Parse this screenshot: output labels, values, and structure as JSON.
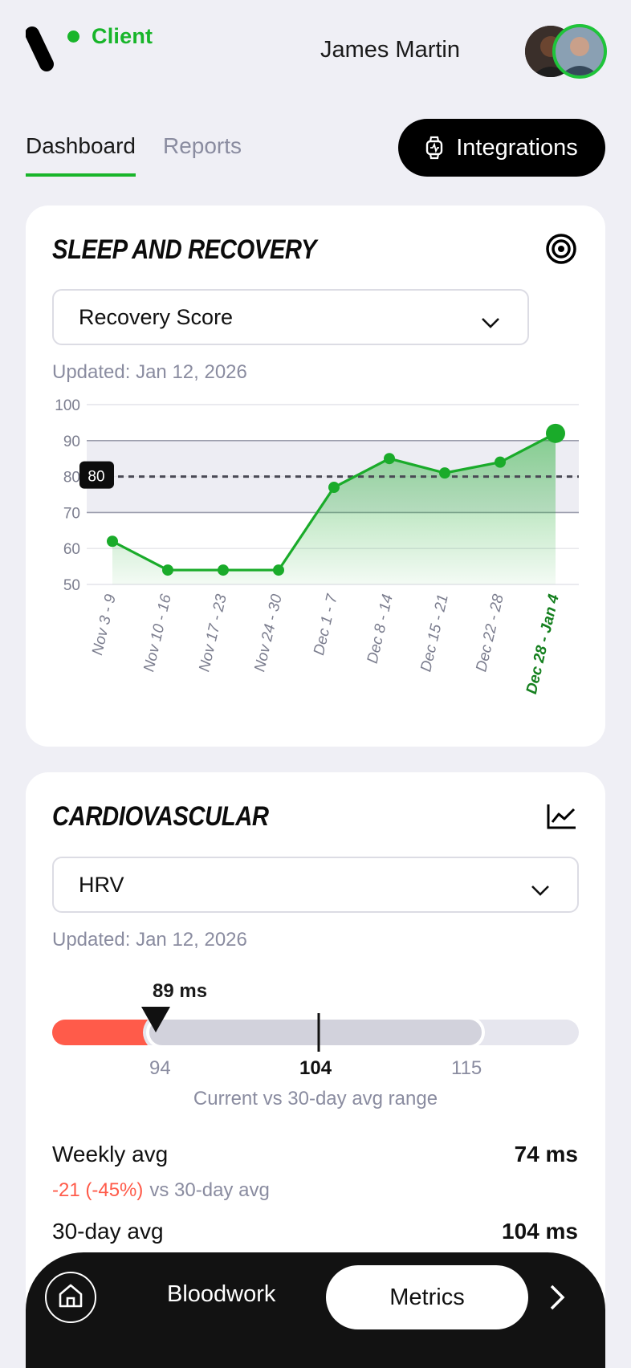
{
  "header": {
    "brand": "Client",
    "user_name": "James Martin",
    "accent": "#18b52a"
  },
  "tabs": [
    {
      "label": "Dashboard",
      "active": true
    },
    {
      "label": "Reports",
      "active": false
    }
  ],
  "integrations_label": "Integrations",
  "sleep_card": {
    "title": "SLEEP AND RECOVERY",
    "icon": "target-icon",
    "select_value": "Recovery Score",
    "updated": "Updated: Jan 12, 2026",
    "target_badge": "80"
  },
  "chart_data": {
    "type": "area",
    "categories": [
      "Nov 3 - 9",
      "Nov 10 - 16",
      "Nov 17 - 23",
      "Nov 24 - 30",
      "Dec 1 - 7",
      "Dec 8 - 14",
      "Dec 15 - 21",
      "Dec 22 - 28",
      "Dec 28 - Jan 4"
    ],
    "values": [
      62,
      54,
      54,
      54,
      77,
      85,
      81,
      84,
      92
    ],
    "yticks": [
      100,
      90,
      80,
      70,
      60,
      50
    ],
    "ylim": [
      50,
      100
    ],
    "target": 80,
    "highlight_index": 8,
    "line_color": "#1aab2a",
    "grid": true
  },
  "cardio_card": {
    "title": "CARDIOVASCULAR",
    "icon": "line-chart-icon",
    "select_value": "HRV",
    "updated": "Updated: Jan 12, 2026",
    "current_label": "89 ms",
    "range_low": "94",
    "range_mid": "104",
    "range_high": "115",
    "range_caption": "Current vs 30-day avg range",
    "weekly_label": "Weekly avg",
    "weekly_value": "74 ms",
    "weekly_delta": "-21 (-45%)",
    "weekly_vs": "vs 30-day avg",
    "avg30_label": "30-day avg",
    "avg30_value": "104 ms"
  },
  "bottom_nav": {
    "home_icon": "home-icon",
    "bloodwork": "Bloodwork",
    "metrics": "Metrics",
    "next_icon": "chevron-right-icon"
  }
}
